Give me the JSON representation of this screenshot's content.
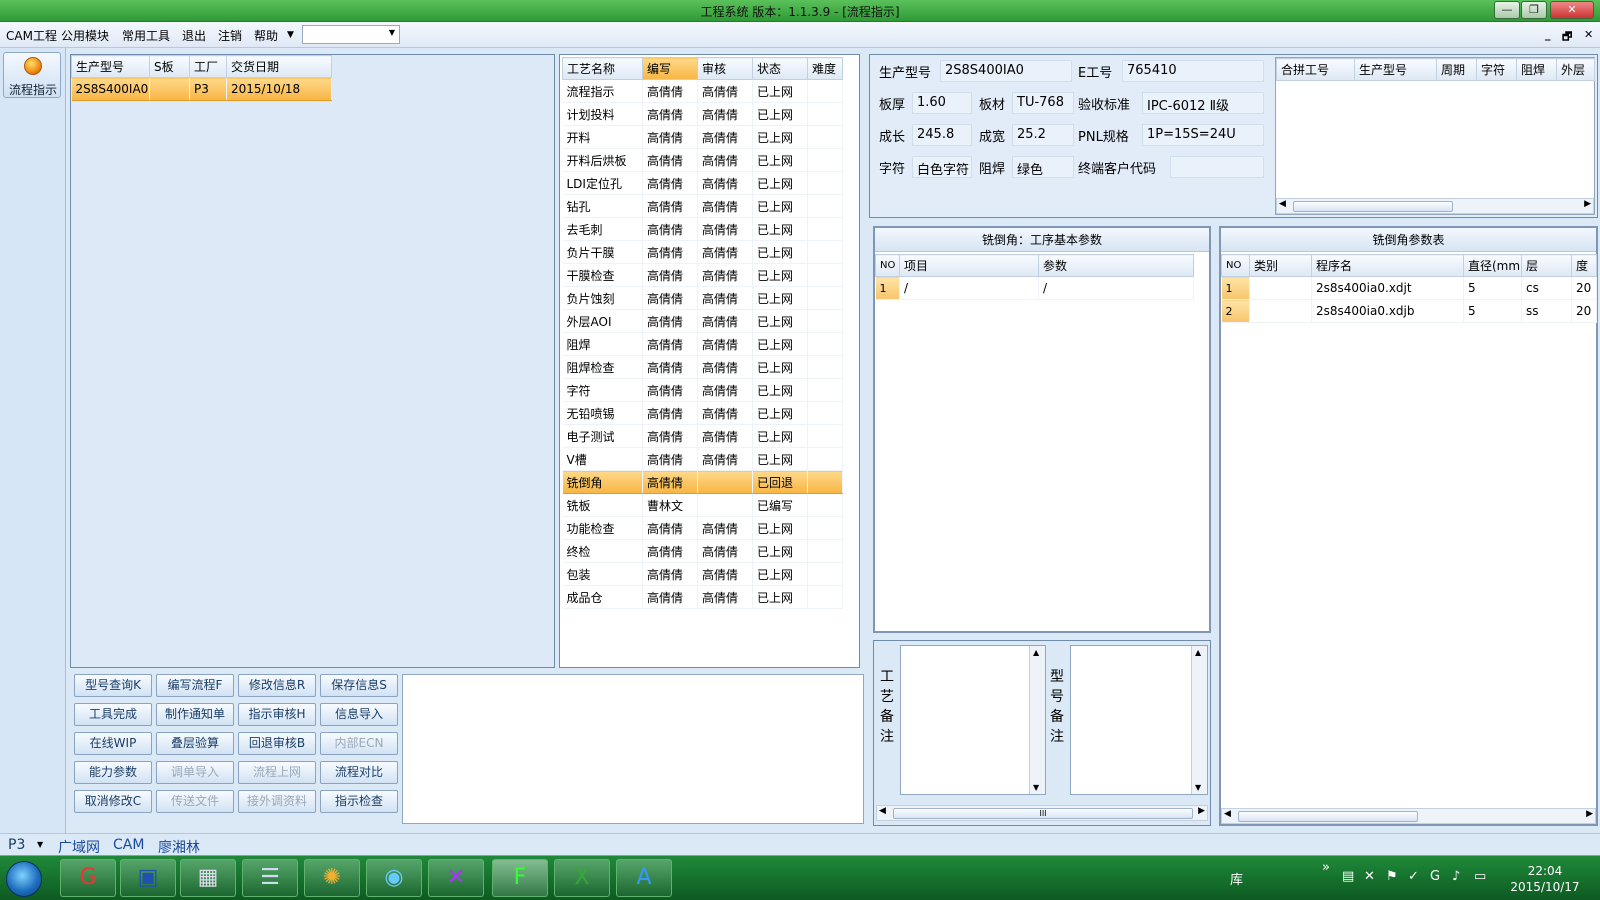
{
  "window": {
    "title": "工程系统   版本：1.1.3.9 - [流程指示]",
    "min": "—",
    "max": "❐",
    "close": "✕"
  },
  "menu": {
    "items": [
      "CAM工程",
      "公用模块",
      "常用工具",
      "退出",
      "注销",
      "帮助"
    ],
    "combo_value": "",
    "mdi": [
      "_",
      "🗗",
      "✕"
    ]
  },
  "sidebar": {
    "flow_button": "流程指示"
  },
  "model_list": {
    "columns": [
      "生产型号",
      "S板",
      "工厂",
      "交货日期"
    ],
    "rows": [
      [
        "2S8S400IA0",
        "",
        "P3",
        "2015/10/18"
      ]
    ]
  },
  "process_table": {
    "columns": [
      "工艺名称",
      "编写",
      "审核",
      "状态",
      "难度"
    ],
    "rows": [
      [
        "流程指示",
        "高倩倩",
        "高倩倩",
        "已上网",
        ""
      ],
      [
        "计划投料",
        "高倩倩",
        "高倩倩",
        "已上网",
        ""
      ],
      [
        "开料",
        "高倩倩",
        "高倩倩",
        "已上网",
        ""
      ],
      [
        "开料后烘板",
        "高倩倩",
        "高倩倩",
        "已上网",
        ""
      ],
      [
        "LDI定位孔",
        "高倩倩",
        "高倩倩",
        "已上网",
        ""
      ],
      [
        "钻孔",
        "高倩倩",
        "高倩倩",
        "已上网",
        ""
      ],
      [
        "去毛刺",
        "高倩倩",
        "高倩倩",
        "已上网",
        ""
      ],
      [
        "负片干膜",
        "高倩倩",
        "高倩倩",
        "已上网",
        ""
      ],
      [
        "干膜检查",
        "高倩倩",
        "高倩倩",
        "已上网",
        ""
      ],
      [
        "负片蚀刻",
        "高倩倩",
        "高倩倩",
        "已上网",
        ""
      ],
      [
        "外层AOI",
        "高倩倩",
        "高倩倩",
        "已上网",
        ""
      ],
      [
        "阻焊",
        "高倩倩",
        "高倩倩",
        "已上网",
        ""
      ],
      [
        "阻焊检查",
        "高倩倩",
        "高倩倩",
        "已上网",
        ""
      ],
      [
        "字符",
        "高倩倩",
        "高倩倩",
        "已上网",
        ""
      ],
      [
        "无铅喷锡",
        "高倩倩",
        "高倩倩",
        "已上网",
        ""
      ],
      [
        "电子测试",
        "高倩倩",
        "高倩倩",
        "已上网",
        ""
      ],
      [
        "V槽",
        "高倩倩",
        "高倩倩",
        "已上网",
        ""
      ],
      [
        "铣倒角",
        "高倩倩",
        "",
        "已回退",
        ""
      ],
      [
        "铣板",
        "曹林文",
        "",
        "已编写",
        ""
      ],
      [
        "功能检查",
        "高倩倩",
        "高倩倩",
        "已上网",
        ""
      ],
      [
        "终检",
        "高倩倩",
        "高倩倩",
        "已上网",
        ""
      ],
      [
        "包装",
        "高倩倩",
        "高倩倩",
        "已上网",
        ""
      ],
      [
        "成品仓",
        "高倩倩",
        "高倩倩",
        "已上网",
        ""
      ]
    ],
    "selected_index": 17
  },
  "info": {
    "model_label": "生产型号",
    "model_value": "2S8S400IA0",
    "eno_label": "E工号",
    "eno_value": "765410",
    "thick_label": "板厚",
    "thick_value": "1.60",
    "mat_label": "板材",
    "mat_value": "TU-768",
    "std_label": "验收标准",
    "std_value": "IPC-6012 Ⅱ级",
    "len_label": "成长",
    "len_value": "245.8",
    "wid_label": "成宽",
    "wid_value": "25.2",
    "pnl_label": "PNL规格",
    "pnl_value": "1P=15S=24U",
    "char_label": "字符",
    "char_value": "白色字符",
    "mask_label": "阻焊",
    "mask_value": "绿色",
    "cust_label": "终端客户代码",
    "cust_value": ""
  },
  "merge_table": {
    "columns": [
      "合拼工号",
      "生产型号",
      "周期",
      "字符",
      "阻焊",
      "外层"
    ]
  },
  "basic_params": {
    "title": "铣倒角：工序基本参数",
    "columns": [
      "NO",
      "项目",
      "参数"
    ],
    "rows": [
      [
        "1",
        "/",
        "/"
      ]
    ]
  },
  "chamfer_params": {
    "title": "铣倒角参数表",
    "columns": [
      "NO",
      "类别",
      "程序名",
      "直径(mm)",
      "层",
      "度"
    ],
    "rows": [
      [
        "1",
        "",
        "2s8s400ia0.xdjt",
        "5",
        "cs",
        "20"
      ],
      [
        "2",
        "",
        "2s8s400ia0.xdjb",
        "5",
        "ss",
        "20"
      ]
    ]
  },
  "notes": {
    "process_label": "工艺备注",
    "model_label": "型号备注",
    "scroll_mark": "III"
  },
  "buttons": [
    {
      "label": "型号查询K",
      "enabled": true
    },
    {
      "label": "编写流程F",
      "enabled": true
    },
    {
      "label": "修改信息R",
      "enabled": true
    },
    {
      "label": "保存信息S",
      "enabled": true
    },
    {
      "label": "工具完成",
      "enabled": true
    },
    {
      "label": "制作通知单",
      "enabled": true
    },
    {
      "label": "指示审核H",
      "enabled": true
    },
    {
      "label": "信息导入",
      "enabled": true
    },
    {
      "label": "在线WIP",
      "enabled": true
    },
    {
      "label": "叠层验算",
      "enabled": true
    },
    {
      "label": "回退审核B",
      "enabled": true
    },
    {
      "label": "内部ECN",
      "enabled": false
    },
    {
      "label": "能力参数",
      "enabled": true
    },
    {
      "label": "调单导入",
      "enabled": false
    },
    {
      "label": "流程上网",
      "enabled": false
    },
    {
      "label": "流程对比",
      "enabled": true
    },
    {
      "label": "取消修改C",
      "enabled": true
    },
    {
      "label": "传送文件",
      "enabled": false
    },
    {
      "label": "接外调资料",
      "enabled": false
    },
    {
      "label": "指示检查",
      "enabled": true
    }
  ],
  "statusbar": {
    "factory": "P3",
    "network": "广域网",
    "dept": "CAM",
    "user": "廖湘林"
  },
  "taskbar": {
    "tray_lib": "库",
    "tray_chevron": "»",
    "time": "22:04",
    "date": "2015/10/17"
  },
  "colors": {
    "accent_selected": "#f7b543",
    "titlebar": "#2f9a36",
    "taskbar": "#0d5a22"
  }
}
